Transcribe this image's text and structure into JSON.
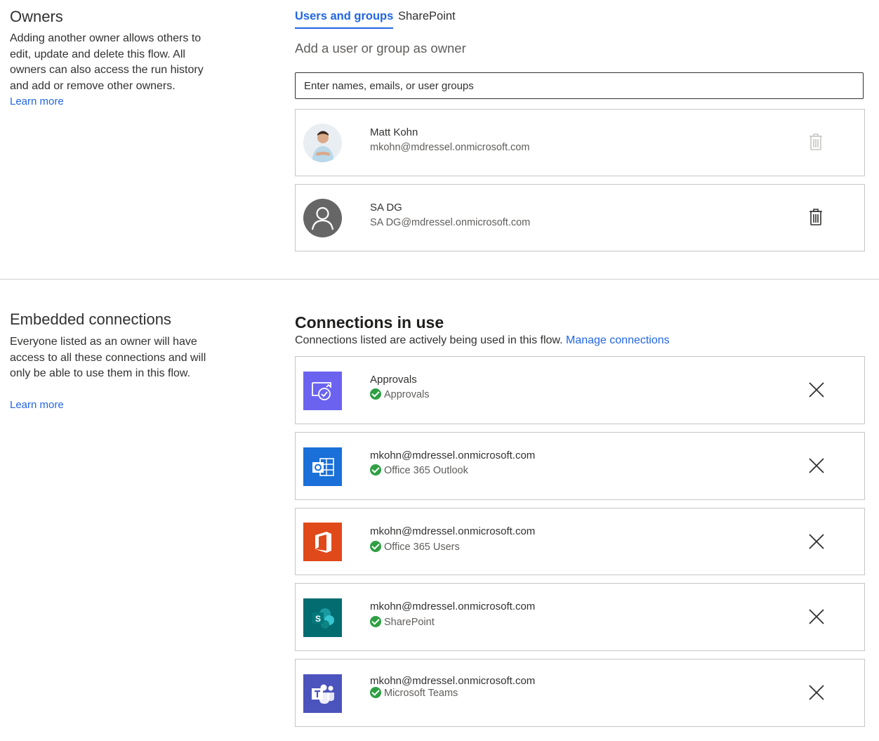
{
  "owners": {
    "title": "Owners",
    "description": "Adding another owner allows others to edit, update and delete this flow. All owners can also access the run history and add or remove other owners.",
    "learn_more": "Learn more"
  },
  "tabs": [
    {
      "label": "Users and groups",
      "active": true
    },
    {
      "label": "SharePoint",
      "active": false
    }
  ],
  "add_owner": {
    "heading": "Add a user or group as owner",
    "placeholder": "Enter names, emails, or user groups"
  },
  "owner_list": [
    {
      "name": "Matt Kohn",
      "email": "mkohn@mdressel.onmicrosoft.com",
      "avatar": "photo",
      "delete_enabled": false
    },
    {
      "name": "SA DG",
      "email": "SA DG@mdressel.onmicrosoft.com",
      "avatar": "person-icon",
      "delete_enabled": true
    }
  ],
  "embedded": {
    "title": "Embedded connections",
    "description": "Everyone listed as an owner will have access to all these connections and will only be able to use them in this flow.",
    "learn_more": "Learn more"
  },
  "connections": {
    "heading": "Connections in use",
    "description": "Connections listed are actively being used in this flow.",
    "manage_link": "Manage connections",
    "items": [
      {
        "account": "Approvals",
        "service": "Approvals",
        "icon": "approvals-icon",
        "color": "#6b63f0"
      },
      {
        "account": "mkohn@mdressel.onmicrosoft.com",
        "service": "Office 365 Outlook",
        "icon": "outlook-icon",
        "color": "#1a6fd8"
      },
      {
        "account": "mkohn@mdressel.onmicrosoft.com",
        "service": "Office 365 Users",
        "icon": "office-icon",
        "color": "#e0491a"
      },
      {
        "account": "mkohn@mdressel.onmicrosoft.com",
        "service": "SharePoint",
        "icon": "sharepoint-icon",
        "color": "#036c70"
      },
      {
        "account": "mkohn@mdressel.onmicrosoft.com",
        "service": "Microsoft Teams",
        "icon": "teams-icon",
        "color": "#4b53bc"
      }
    ]
  }
}
